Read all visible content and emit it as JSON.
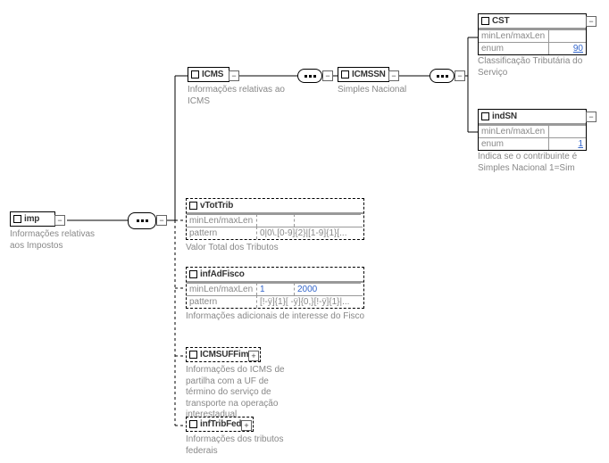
{
  "imp": {
    "title": "imp",
    "caption": "Informações relativas aos Impostos"
  },
  "icms": {
    "title": "ICMS",
    "caption": "Informações relativas ao ICMS"
  },
  "icmssn": {
    "title": "ICMSSN",
    "caption": "Simples Nacional"
  },
  "cst": {
    "title": "CST",
    "labelMinMax": "minLen/maxLen",
    "labelEnum": "enum",
    "valueEnum": "90",
    "caption": "Classificação Tributária do Serviço"
  },
  "indsn": {
    "title": "indSN",
    "labelMinMax": "minLen/maxLen",
    "labelEnum": "enum",
    "valueEnum": "1",
    "caption": "Indica se o contribuinte é Simples Nacional 1=Sim"
  },
  "vtottrib": {
    "title": "vTotTrib",
    "labelMinMax": "minLen/maxLen",
    "labelPattern": "pattern",
    "valuePattern": "0|0\\.[0-9]{2}|[1-9]{1}[...",
    "caption": "Valor Total dos Tributos"
  },
  "infadfisco": {
    "title": "infAdFisco",
    "labelMinMax": "minLen/maxLen",
    "minA": "1",
    "minB": "2000",
    "labelPattern": "pattern",
    "valuePattern": "[!-ÿ]{1}[ -ÿ]{0,}[!-ÿ]{1}|...",
    "caption": "Informações adicionais de interesse do Fisco"
  },
  "icmsuffim": {
    "title": "ICMSUFFim",
    "caption": "Informações do ICMS de partilha com a UF de término do serviço de transporte na operação interestadual"
  },
  "inftribfed": {
    "title": "infTribFed",
    "caption": "Informações dos tributos federais"
  }
}
